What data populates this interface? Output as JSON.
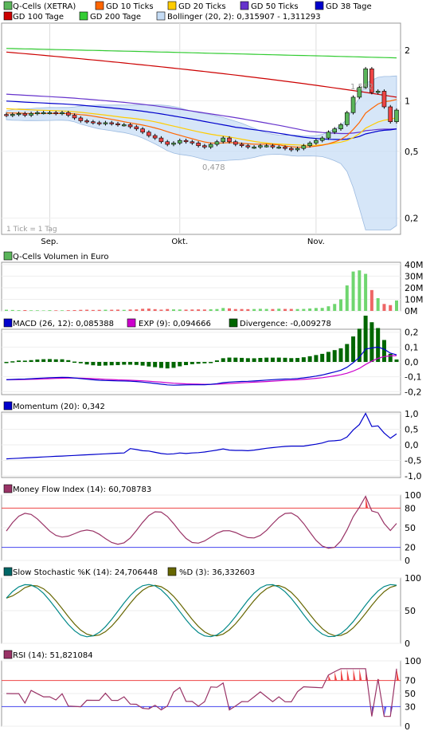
{
  "main_legend": [
    {
      "label": "Q-Cells (XETRA)",
      "color": "#5ab55a"
    },
    {
      "label": "GD 10 Ticks",
      "color": "#ff6600"
    },
    {
      "label": "GD 20 Ticks",
      "color": "#ffcc00"
    },
    {
      "label": "GD 50 Ticks",
      "color": "#6633cc"
    },
    {
      "label": "GD 38 Tage",
      "color": "#0000cc"
    },
    {
      "label": "GD 100 Tage",
      "color": "#cc0000"
    },
    {
      "label": "GD 200 Tage",
      "color": "#33cc33"
    },
    {
      "label": "Bollinger (20, 2): 0,315907 - 1,311293",
      "color": "#c5dcf5"
    }
  ],
  "main": {
    "y_ticks": [
      {
        "value": 2,
        "label": "2"
      },
      {
        "value": 1,
        "label": "1"
      },
      {
        "value": 0.5,
        "label": "0,5"
      },
      {
        "value": 0.2,
        "label": "0,2"
      }
    ],
    "annotations": {
      "high": "1,552",
      "low": "0,478"
    },
    "tick_note": "1 Tick = 1 Tag",
    "x_labels": [
      {
        "label": "Sep.",
        "index": 7
      },
      {
        "label": "Okt.",
        "index": 28
      },
      {
        "label": "Nov.",
        "index": 50
      }
    ]
  },
  "volume_panel": {
    "legend": "Q-Cells Volumen in Euro",
    "y_ticks": [
      "40M",
      "30M",
      "20M",
      "10M",
      "0M"
    ]
  },
  "macd_panel": {
    "legend": [
      {
        "label": "MACD (26, 12): 0,085388",
        "color": "#0000cc"
      },
      {
        "label": "EXP (9): 0,094666",
        "color": "#cc00cc"
      },
      {
        "label": "Divergence: -0,009278",
        "color": "#006600"
      }
    ],
    "y_ticks": [
      "0,2",
      "0,1",
      "0,0",
      "-0,1",
      "-0,2"
    ]
  },
  "momentum_panel": {
    "legend": "Momentum (20): 0,342",
    "y_ticks": [
      "1,0",
      "0,5",
      "0,0",
      "-0,5",
      "-1,0"
    ]
  },
  "mfi_panel": {
    "legend": "Money Flow Index (14): 60,708783",
    "y_ticks": [
      "100",
      "80",
      "50",
      "20",
      "0"
    ]
  },
  "stoch_panel": {
    "legend": [
      {
        "label": "Slow Stochastic %K (14): 24,706448",
        "color": "#006666"
      },
      {
        "label": "%D (3): 36,332603",
        "color": "#666600"
      }
    ],
    "y_ticks": [
      "100",
      "50",
      "0"
    ]
  },
  "rsi_panel": {
    "legend": "RSI (14): 51,821084",
    "y_ticks": [
      "100",
      "70",
      "50",
      "30",
      "0"
    ]
  },
  "chart_data": {
    "type": "line",
    "title": "Q-Cells (XETRA)",
    "x_axis": {
      "labels": [
        "Sep.",
        "Okt.",
        "Nov."
      ],
      "count": 64
    },
    "series": [
      {
        "name": "Q-Cells (XETRA) close",
        "values": [
          0.82,
          0.83,
          0.84,
          0.82,
          0.84,
          0.85,
          0.85,
          0.85,
          0.84,
          0.85,
          0.82,
          0.79,
          0.76,
          0.75,
          0.74,
          0.73,
          0.74,
          0.73,
          0.72,
          0.72,
          0.7,
          0.68,
          0.65,
          0.62,
          0.6,
          0.57,
          0.55,
          0.56,
          0.58,
          0.57,
          0.56,
          0.54,
          0.53,
          0.55,
          0.57,
          0.6,
          0.57,
          0.55,
          0.54,
          0.53,
          0.53,
          0.54,
          0.54,
          0.53,
          0.53,
          0.52,
          0.51,
          0.52,
          0.54,
          0.56,
          0.58,
          0.6,
          0.65,
          0.68,
          0.72,
          0.85,
          1.05,
          1.2,
          1.55,
          1.12,
          1.14,
          0.92,
          0.75,
          0.88
        ]
      },
      {
        "name": "GD 200 Tage",
        "values_start": 2.05,
        "values_end": 1.8
      },
      {
        "name": "GD 100 Tage",
        "values_start": 1.95,
        "values_end": 1.05
      }
    ],
    "volume_millions": [
      1,
      0.8,
      0.6,
      0.7,
      0.5,
      0.5,
      0.4,
      0.6,
      0.5,
      0.5,
      0.6,
      0.7,
      0.9,
      1,
      0.8,
      0.9,
      1,
      1,
      1.1,
      0.9,
      1.2,
      1.3,
      1.8,
      2,
      1.5,
      1.1,
      1.6,
      1.3,
      1.2,
      1.1,
      1.2,
      1.3,
      1.2,
      1.4,
      1.6,
      2.5,
      2.2,
      1.6,
      1.6,
      1.5,
      1.6,
      1.8,
      1.7,
      1.6,
      1.9,
      1.7,
      1.7,
      1.6,
      1.7,
      2.1,
      2.5,
      2.6,
      4,
      6,
      10,
      22,
      34,
      35,
      32,
      18,
      11,
      6,
      5,
      9
    ],
    "rsi_current": 51.821084,
    "mfi_current": 60.708783,
    "momentum_current": 0.342,
    "stoch_k_current": 24.706448,
    "stoch_d_current": 36.332603,
    "macd_current": 0.085388,
    "macd_exp_current": 0.094666,
    "macd_divergence_current": -0.009278
  }
}
